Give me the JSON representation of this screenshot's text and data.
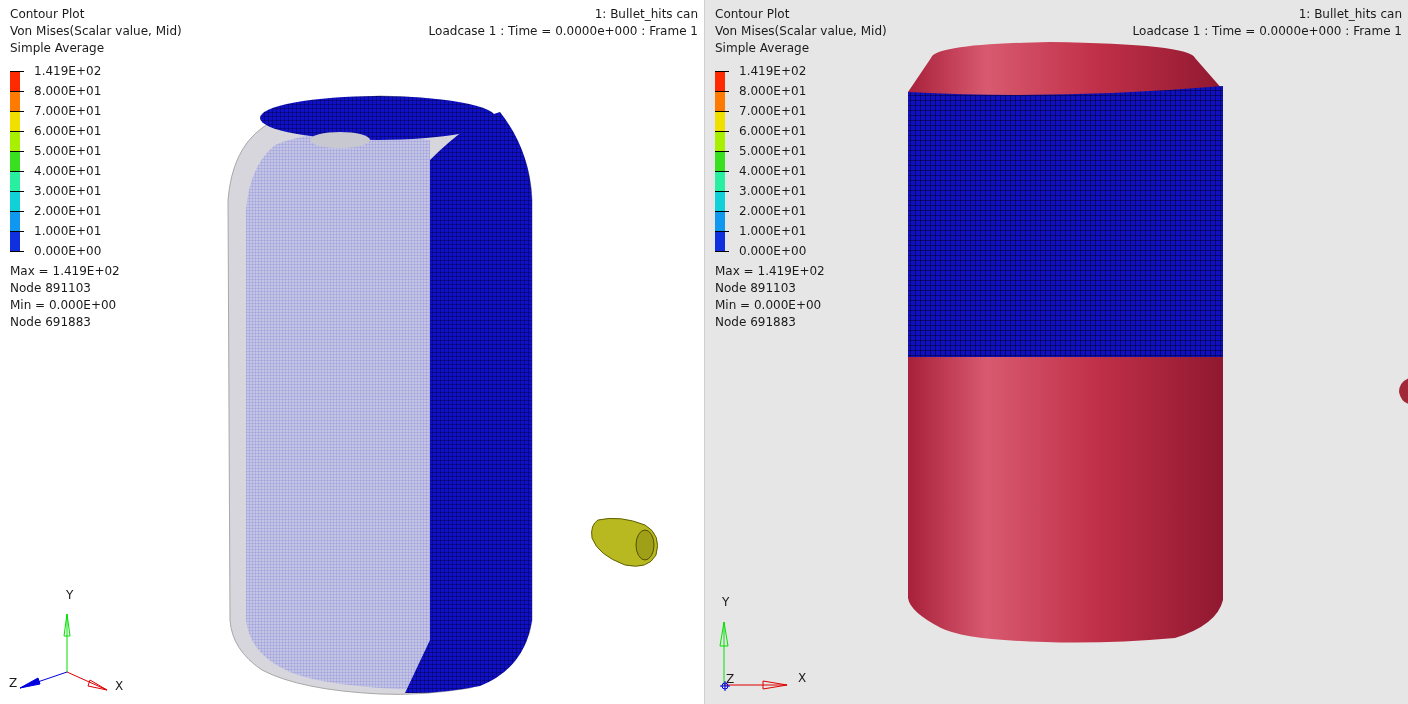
{
  "viewports": [
    {
      "kind": "translucent",
      "header": [
        "Contour Plot",
        "Von Mises(Scalar value, Mid)",
        "Simple Average"
      ],
      "title": "1: Bullet_hits can",
      "subtitle": "Loadcase 1 : Time = 0.0000e+000 : Frame 1",
      "legend": {
        "levels": [
          "1.419E+02",
          "8.000E+01",
          "7.000E+01",
          "6.000E+01",
          "5.000E+01",
          "4.000E+01",
          "3.000E+01",
          "2.000E+01",
          "1.000E+01",
          "0.000E+00"
        ],
        "bands": [
          {
            "color": "#ff2a00"
          },
          {
            "color": "#ff7a00"
          },
          {
            "color": "#f0e000"
          },
          {
            "color": "#a8f000"
          },
          {
            "color": "#38e020"
          },
          {
            "color": "#28f0a0"
          },
          {
            "color": "#10d0d8"
          },
          {
            "color": "#1098f0"
          },
          {
            "color": "#1030e0"
          }
        ]
      },
      "stats": [
        "Max =  1.419E+02",
        "Node 891103",
        "Min =  0.000E+00",
        "Node 691883"
      ],
      "axes": {
        "x": "X",
        "y": "Y",
        "z": "Z"
      }
    },
    {
      "kind": "shaded",
      "header": [
        "Contour Plot",
        "Von Mises(Scalar value, Mid)",
        "Simple Average"
      ],
      "title": "1: Bullet_hits can",
      "subtitle": "Loadcase 1 : Time = 0.0000e+000 : Frame 1",
      "legend": {
        "levels": [
          "1.419E+02",
          "8.000E+01",
          "7.000E+01",
          "6.000E+01",
          "5.000E+01",
          "4.000E+01",
          "3.000E+01",
          "2.000E+01",
          "1.000E+01",
          "0.000E+00"
        ],
        "bands": [
          {
            "color": "#ff2a00"
          },
          {
            "color": "#ff7a00"
          },
          {
            "color": "#f0e000"
          },
          {
            "color": "#a8f000"
          },
          {
            "color": "#38e020"
          },
          {
            "color": "#28f0a0"
          },
          {
            "color": "#10d0d8"
          },
          {
            "color": "#1098f0"
          },
          {
            "color": "#1030e0"
          }
        ]
      },
      "stats": [
        "Max =  1.419E+02",
        "Node 891103",
        "Min =  0.000E+00",
        "Node 691883"
      ],
      "axes": {
        "x": "X",
        "y": "Y",
        "z": "Z"
      }
    }
  ]
}
